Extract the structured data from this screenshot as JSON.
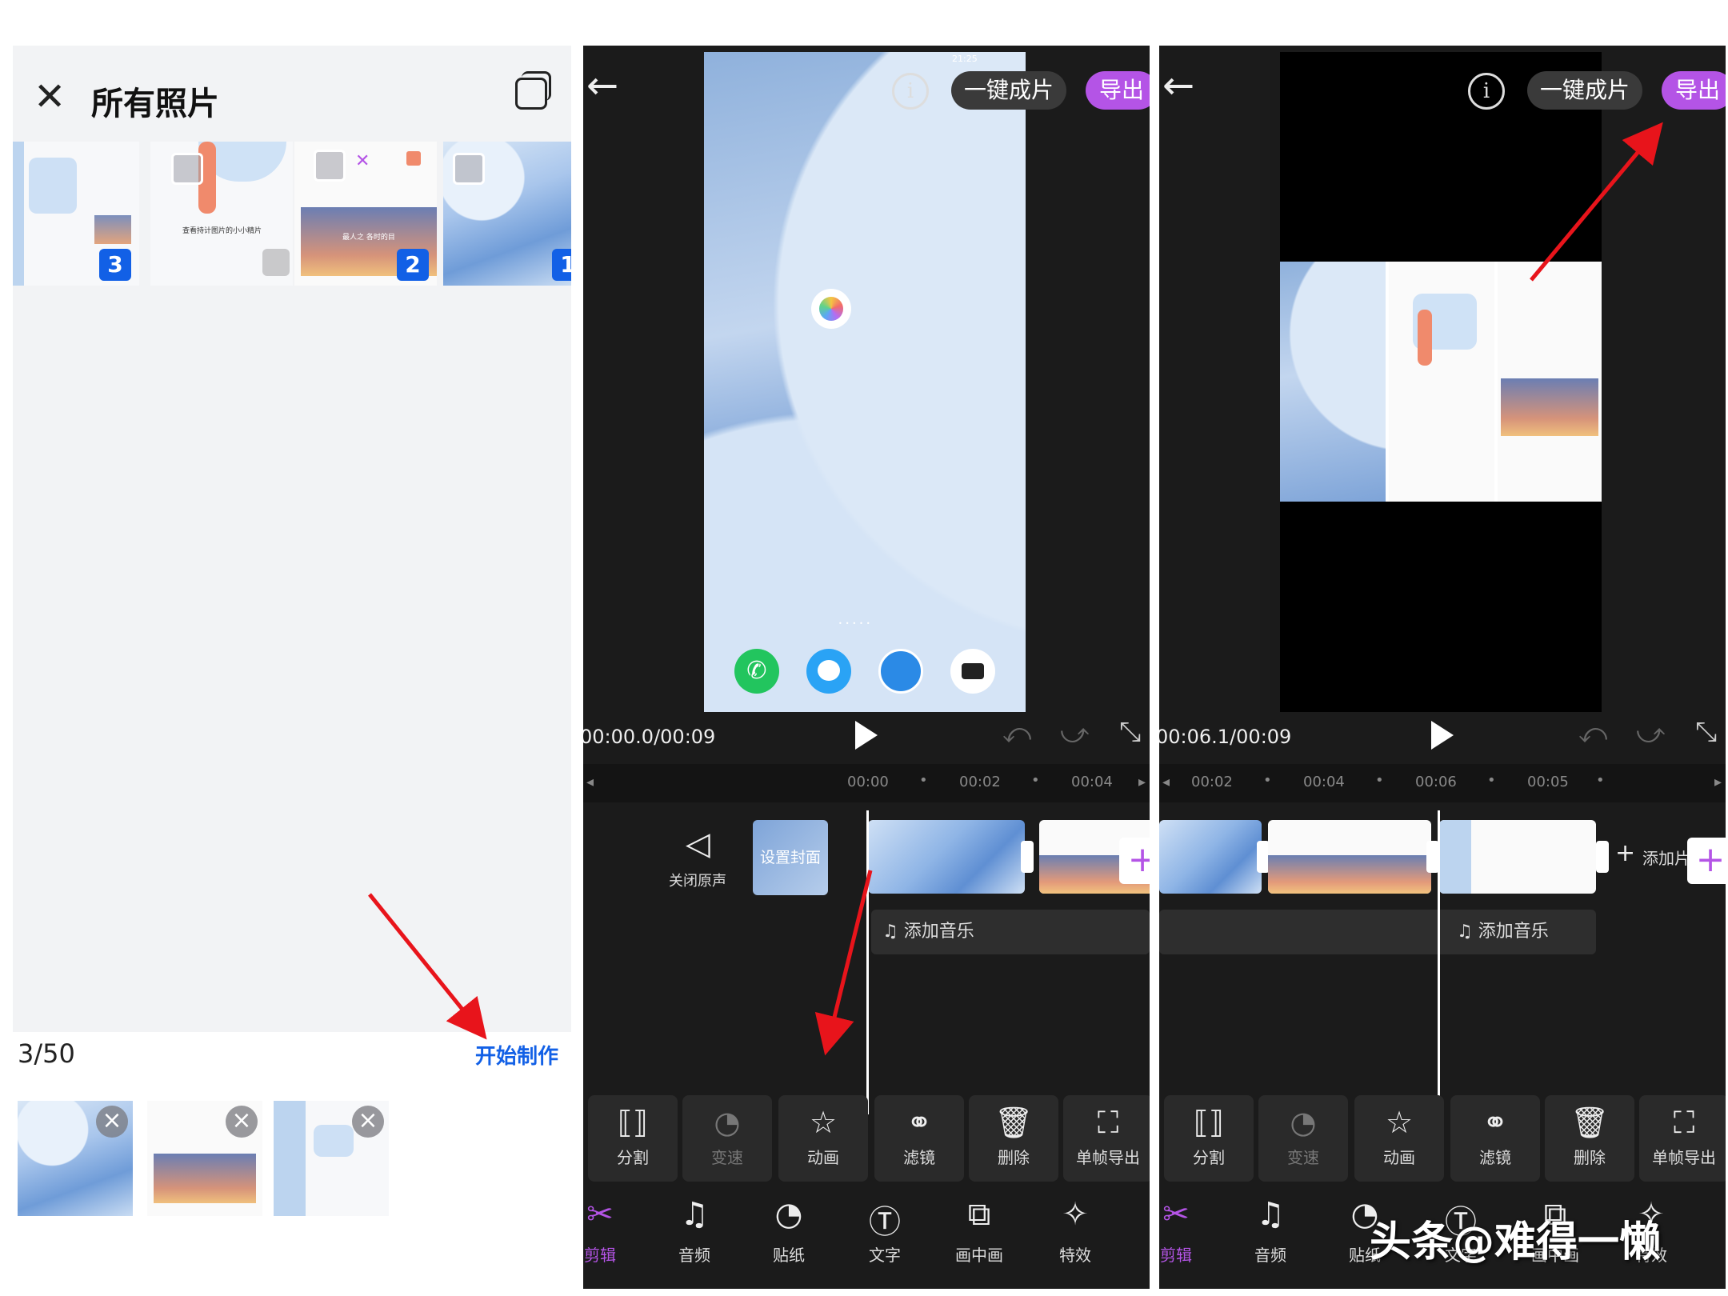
{
  "colors": {
    "accent_purple": "#b454e6",
    "link_blue": "#1260e6",
    "arrow_red": "#e8141b"
  },
  "picker": {
    "close_icon": "close-icon",
    "title": "所有照片",
    "multi_icon": "multi-window-icon",
    "grid": [
      {
        "kind": "app-screens",
        "badge": "3"
      },
      {
        "kind": "illustration",
        "caption": "查看持计图片的小小精片",
        "badge": ""
      },
      {
        "kind": "settings",
        "caption": "最人之 各时的目",
        "badge": "2"
      },
      {
        "kind": "wallpaper",
        "badge": "1"
      }
    ],
    "count": "3/50",
    "start_label": "开始制作",
    "selected": [
      "wallpaper",
      "settings",
      "app-screens"
    ]
  },
  "editor_left": {
    "back_icon": "back-arrow-icon",
    "info_icon": "info-icon",
    "one_click_label": "一键成片",
    "export_label": "导出",
    "timecode": "00:00.0/00:09",
    "ruler_ticks": [
      "00:00",
      "00:02",
      "00:04"
    ],
    "mute_label": "关闭原声",
    "cover_label": "设置封面",
    "add_music_label": "添加音乐",
    "clock": "21:25"
  },
  "editor_right": {
    "back_icon": "back-arrow-icon",
    "info_icon": "info-icon",
    "one_click_label": "一键成片",
    "export_label": "导出",
    "timecode": "00:06.1/00:09",
    "ruler_ticks": [
      "00:02",
      "00:04",
      "00:06",
      "00:05"
    ],
    "add_clip_label": "添加片",
    "add_music_label": "添加音乐"
  },
  "tools": [
    {
      "label": "分割",
      "icon": "split-icon",
      "enabled": true
    },
    {
      "label": "变速",
      "icon": "speed-icon",
      "enabled": false
    },
    {
      "label": "动画",
      "icon": "animation-icon",
      "enabled": true
    },
    {
      "label": "滤镜",
      "icon": "filter-icon",
      "enabled": true
    },
    {
      "label": "删除",
      "icon": "delete-icon",
      "enabled": true
    },
    {
      "label": "单帧导出",
      "icon": "frame-export-icon",
      "enabled": true
    }
  ],
  "nav": [
    {
      "label": "剪辑",
      "icon": "scissors-icon",
      "active": true
    },
    {
      "label": "音频",
      "icon": "music-note-icon",
      "active": false
    },
    {
      "label": "贴纸",
      "icon": "sticker-icon",
      "active": false
    },
    {
      "label": "文字",
      "icon": "text-icon",
      "active": false
    },
    {
      "label": "画中画",
      "icon": "pip-icon",
      "active": false
    },
    {
      "label": "特效",
      "icon": "effects-icon",
      "active": false
    }
  ],
  "watermark": "头条@难得一懒"
}
